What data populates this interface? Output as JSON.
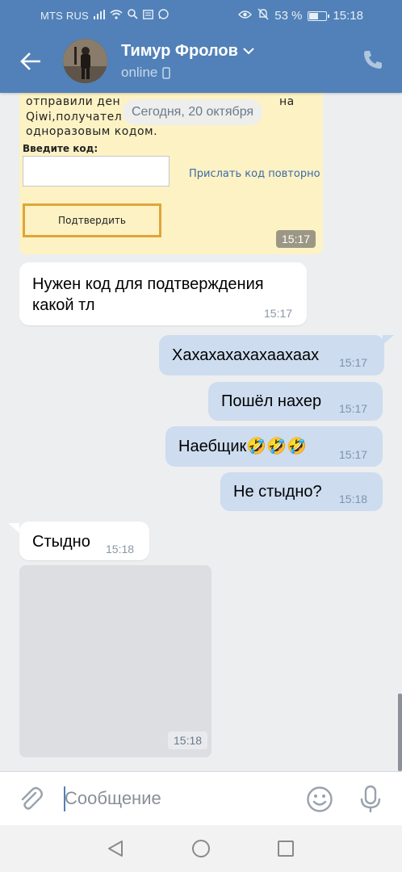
{
  "status_bar": {
    "carrier": "MTS RUS",
    "battery": "53 %",
    "battery_level": 0.53,
    "time": "15:18"
  },
  "header": {
    "contact_name": "Тимур Фролов",
    "status": "online"
  },
  "chat": {
    "date_separator": "Сегодня, 20 октября",
    "screenshot_message": {
      "line1": "отправили ден",
      "line1_right": "на",
      "line2": "Qiwi,получател",
      "line3": "одноразовым кодом.",
      "code_label": "Введите код:",
      "resend_link": "Прислать код повторно",
      "confirm_button": "Подтвердить",
      "time": "15:17"
    },
    "messages": [
      {
        "direction": "incoming",
        "text_line1": "Нужен код для подтверждения",
        "text_line2": "какой тл",
        "time": "15:17"
      },
      {
        "direction": "outgoing",
        "text": "Хахахахахахаахаах",
        "time": "15:17"
      },
      {
        "direction": "outgoing",
        "text": "Пошёл нахер",
        "time": "15:17"
      },
      {
        "direction": "outgoing",
        "text": "Наебщик🤣🤣🤣",
        "time": "15:17"
      },
      {
        "direction": "outgoing",
        "text": "Не стыдно?",
        "time": "15:18"
      },
      {
        "direction": "incoming",
        "text": "Стыдно",
        "time": "15:18"
      }
    ],
    "photo_message": {
      "time": "15:18"
    }
  },
  "composer": {
    "placeholder": "Сообщение",
    "value": ""
  },
  "colors": {
    "header": "#5181b8",
    "incoming_bubble": "#ffffff",
    "outgoing_bubble": "#cddcef",
    "background": "#edeef0"
  }
}
